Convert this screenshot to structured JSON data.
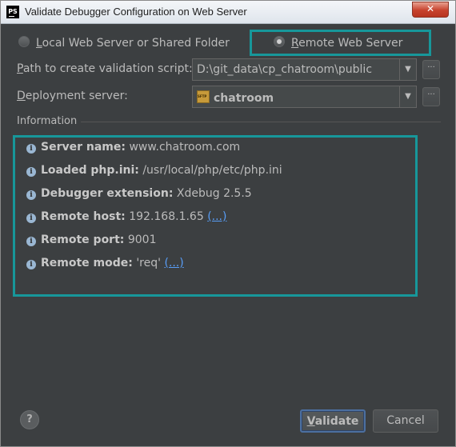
{
  "window": {
    "app_icon": "PS",
    "title": "Validate Debugger Configuration on Web Server",
    "close_symbol": "✕"
  },
  "options": {
    "local": {
      "label_first": "L",
      "label_rest": "ocal Web Server or Shared Folder",
      "selected": false
    },
    "remote": {
      "label_first": "R",
      "label_rest": "emote Web Server",
      "selected": true
    }
  },
  "form": {
    "path_label_first": "P",
    "path_label_rest": "ath to create validation script:",
    "path_value": "D:\\git_data\\cp_chatroom\\public",
    "deploy_label_first": "D",
    "deploy_label_rest": "eployment server:",
    "deploy_value": "chatroom",
    "dots": "···",
    "arrow": "▼"
  },
  "information": {
    "heading": "Information",
    "rows": [
      {
        "key": "Server name:",
        "value": "www.chatroom.com",
        "link": ""
      },
      {
        "key": "Loaded php.ini:",
        "value": "/usr/local/php/etc/php.ini",
        "link": ""
      },
      {
        "key": "Debugger extension:",
        "value": "Xdebug 2.5.5",
        "link": ""
      },
      {
        "key": "Remote host:",
        "value": "192.168.1.65",
        "link": "(...)"
      },
      {
        "key": "Remote port:",
        "value": "9001",
        "link": ""
      },
      {
        "key": "Remote mode:",
        "value": "'req'",
        "link": "(...)"
      }
    ]
  },
  "buttons": {
    "help": "?",
    "validate_first": "V",
    "validate_rest": "alidate",
    "cancel": "Cancel"
  },
  "colors": {
    "highlight": "#17979a",
    "link": "#589df6",
    "background": "#3c3f41"
  }
}
